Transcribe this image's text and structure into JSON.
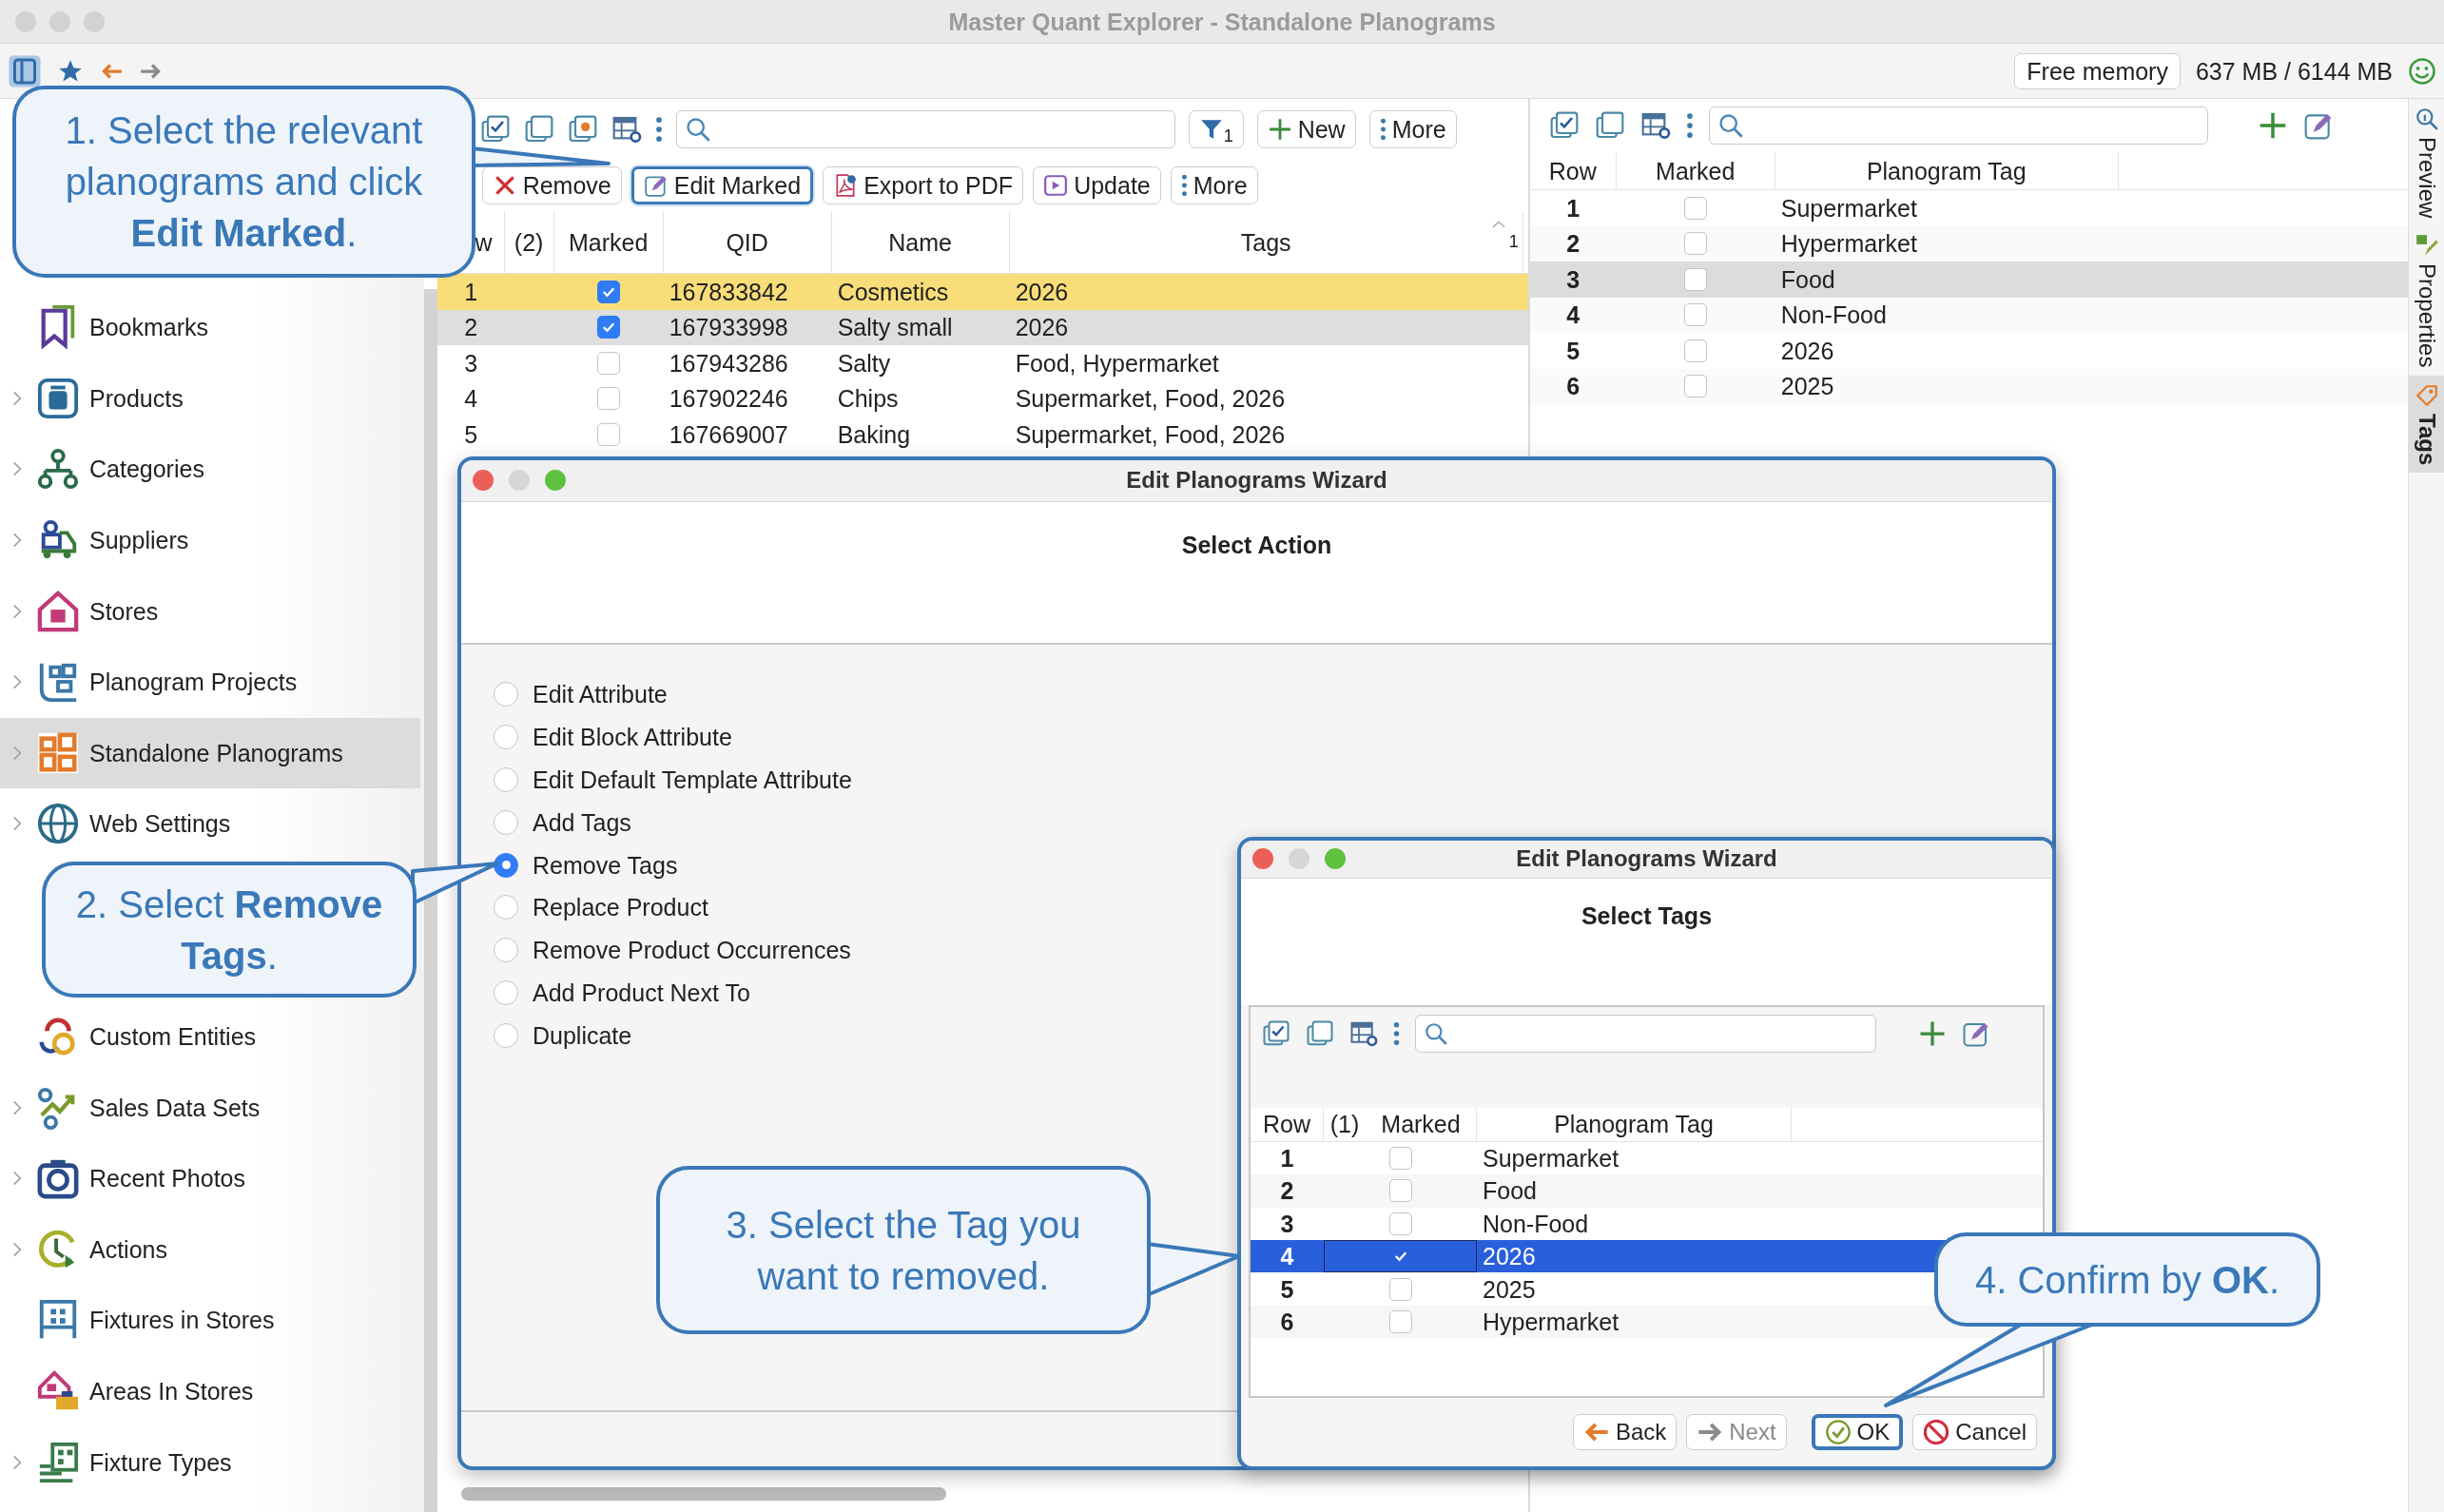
{
  "window": {
    "title": "Master Quant Explorer - Standalone Planograms"
  },
  "status": {
    "memory_button": "Free memory",
    "memory_reading": "637 MB / 6144 MB"
  },
  "sidebar": {
    "items": [
      {
        "label": "Bookmarks",
        "expandable": false,
        "selected": false
      },
      {
        "label": "Products",
        "expandable": true,
        "selected": false
      },
      {
        "label": "Categories",
        "expandable": true,
        "selected": false
      },
      {
        "label": "Suppliers",
        "expandable": true,
        "selected": false
      },
      {
        "label": "Stores",
        "expandable": true,
        "selected": false
      },
      {
        "label": "Planogram Projects",
        "expandable": true,
        "selected": false
      },
      {
        "label": "Standalone Planograms",
        "expandable": true,
        "selected": true
      },
      {
        "label": "Web Settings",
        "expandable": true,
        "selected": false
      },
      {
        "label": "Custom Entities",
        "expandable": false,
        "selected": false
      },
      {
        "label": "Sales Data Sets",
        "expandable": true,
        "selected": false
      },
      {
        "label": "Recent Photos",
        "expandable": true,
        "selected": false
      },
      {
        "label": "Actions",
        "expandable": true,
        "selected": false
      },
      {
        "label": "Fixtures in Stores",
        "expandable": false,
        "selected": false
      },
      {
        "label": "Areas In Stores",
        "expandable": false,
        "selected": false
      },
      {
        "label": "Fixture Types",
        "expandable": true,
        "selected": false
      }
    ]
  },
  "planograms": {
    "filter_count": "1",
    "new_button": "New",
    "more_button": "More",
    "actions": [
      {
        "label": "Remove",
        "kind": "remove",
        "focused": false
      },
      {
        "label": "Edit Marked",
        "kind": "edit",
        "focused": true
      },
      {
        "label": "Export to PDF",
        "kind": "pdf",
        "focused": false
      },
      {
        "label": "Update",
        "kind": "update",
        "focused": false
      },
      {
        "label": "More",
        "kind": "more",
        "focused": false
      }
    ],
    "columns": [
      "w",
      "(2)",
      "Marked",
      "QID",
      "Name",
      "Tags"
    ],
    "sort_count": "1",
    "rows": [
      {
        "row": "1",
        "marked": true,
        "qid": "167833842",
        "name": "Cosmetics",
        "tags": "2026",
        "selected": true,
        "hovered": false
      },
      {
        "row": "2",
        "marked": true,
        "qid": "167933998",
        "name": "Salty small",
        "tags": "2026",
        "selected": false,
        "hovered": true
      },
      {
        "row": "3",
        "marked": false,
        "qid": "167943286",
        "name": "Salty",
        "tags": "Food, Hypermarket",
        "selected": false,
        "hovered": false
      },
      {
        "row": "4",
        "marked": false,
        "qid": "167902246",
        "name": "Chips",
        "tags": "Supermarket, Food, 2026",
        "selected": false,
        "hovered": false
      },
      {
        "row": "5",
        "marked": false,
        "qid": "167669007",
        "name": "Baking",
        "tags": "Supermarket, Food, 2026",
        "selected": false,
        "hovered": false
      }
    ]
  },
  "tags_panel": {
    "columns": [
      "Row",
      "Marked",
      "Planogram Tag"
    ],
    "rows": [
      {
        "row": "1",
        "marked": false,
        "tag": "Supermarket",
        "selected": false
      },
      {
        "row": "2",
        "marked": false,
        "tag": "Hypermarket",
        "selected": false
      },
      {
        "row": "3",
        "marked": false,
        "tag": "Food",
        "selected": true
      },
      {
        "row": "4",
        "marked": false,
        "tag": "Non-Food",
        "selected": false
      },
      {
        "row": "5",
        "marked": false,
        "tag": "2026",
        "selected": false
      },
      {
        "row": "6",
        "marked": false,
        "tag": "2025",
        "selected": false
      }
    ]
  },
  "side_tabs": [
    {
      "label": "Preview",
      "selected": false
    },
    {
      "label": "Properties",
      "selected": false
    },
    {
      "label": "Tags",
      "selected": true
    }
  ],
  "action_dialog": {
    "title": "Edit Planograms Wizard",
    "heading": "Select Action",
    "options": [
      {
        "label": "Edit Attribute",
        "selected": false
      },
      {
        "label": "Edit Block Attribute",
        "selected": false
      },
      {
        "label": "Edit Default Template Attribute",
        "selected": false
      },
      {
        "label": "Add Tags",
        "selected": false
      },
      {
        "label": "Remove Tags",
        "selected": true
      },
      {
        "label": "Replace Product",
        "selected": false
      },
      {
        "label": "Remove Product Occurrences",
        "selected": false
      },
      {
        "label": "Add Product Next To",
        "selected": false
      },
      {
        "label": "Duplicate",
        "selected": false
      }
    ]
  },
  "tags_dialog": {
    "title": "Edit Planograms Wizard",
    "heading": "Select Tags",
    "columns": [
      "Row",
      "(1)",
      "Marked",
      "Planogram Tag"
    ],
    "rows": [
      {
        "row": "1",
        "marked": false,
        "tag": "Supermarket",
        "selected": false
      },
      {
        "row": "2",
        "marked": false,
        "tag": "Food",
        "selected": false
      },
      {
        "row": "3",
        "marked": false,
        "tag": "Non-Food",
        "selected": false
      },
      {
        "row": "4",
        "marked": true,
        "tag": "2026",
        "selected": true
      },
      {
        "row": "5",
        "marked": false,
        "tag": "2025",
        "selected": false
      },
      {
        "row": "6",
        "marked": false,
        "tag": "Hypermarket",
        "selected": false
      }
    ],
    "buttons": [
      {
        "label": "Back",
        "kind": "back",
        "disabled": false,
        "focused": false
      },
      {
        "label": "Next",
        "kind": "next",
        "disabled": true,
        "focused": false
      },
      {
        "label": "OK",
        "kind": "ok",
        "disabled": false,
        "focused": true
      },
      {
        "label": "Cancel",
        "kind": "cancel",
        "disabled": false,
        "focused": false
      }
    ]
  },
  "callouts": [
    {
      "text": "1. Select the relevant planograms and click **Edit Marked**."
    },
    {
      "text": "2. Select **Remove Tags**."
    },
    {
      "text": "3. Select the Tag you want to removed."
    },
    {
      "text": "4. Confirm by **OK**."
    }
  ]
}
